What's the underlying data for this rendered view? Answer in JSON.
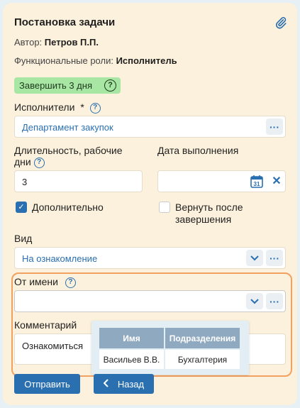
{
  "form": {
    "title": "Постановка задачи",
    "author_label": "Автор: ",
    "author_value": "Петров П.П.",
    "roles_label": "Функциональные роли: ",
    "roles_value": "Исполнитель",
    "deadline_badge": "Завершить 3 дня",
    "help_glyph": "?"
  },
  "executors": {
    "label": "Исполнители",
    "required_mark": "*",
    "value": "Департамент закупок",
    "more_glyph": "···"
  },
  "duration": {
    "label_line1": "Длительность, рабочие",
    "label_line2": "дни",
    "value": "3"
  },
  "due_date": {
    "label": "Дата выполнения",
    "value": "",
    "calendar_glyph": "31",
    "clear_glyph": "✕"
  },
  "options": {
    "additional_label": "Дополнительно",
    "additional_checked": true,
    "return_label_line1": "Вернуть после",
    "return_label_line2": "завершения",
    "return_checked": false
  },
  "kind": {
    "label": "Вид",
    "value": "На ознакомление",
    "more_glyph": "···"
  },
  "on_behalf": {
    "label": "От имени",
    "value": "",
    "more_glyph": "···"
  },
  "comment": {
    "label": "Комментарий",
    "value": "Ознакомиться"
  },
  "popup": {
    "columns": [
      "Имя",
      "Подразделения"
    ],
    "rows": [
      [
        "Васильев В.В.",
        "Бухгалтерия"
      ]
    ]
  },
  "buttons": {
    "send": "Отправить",
    "back": "Назад"
  },
  "colors": {
    "accent": "#2a6fb0",
    "card_bg": "#fcf1dc",
    "badge_bg": "#a8e6a3",
    "highlight_border": "#f2a160",
    "table_header": "#8fa9c0"
  }
}
